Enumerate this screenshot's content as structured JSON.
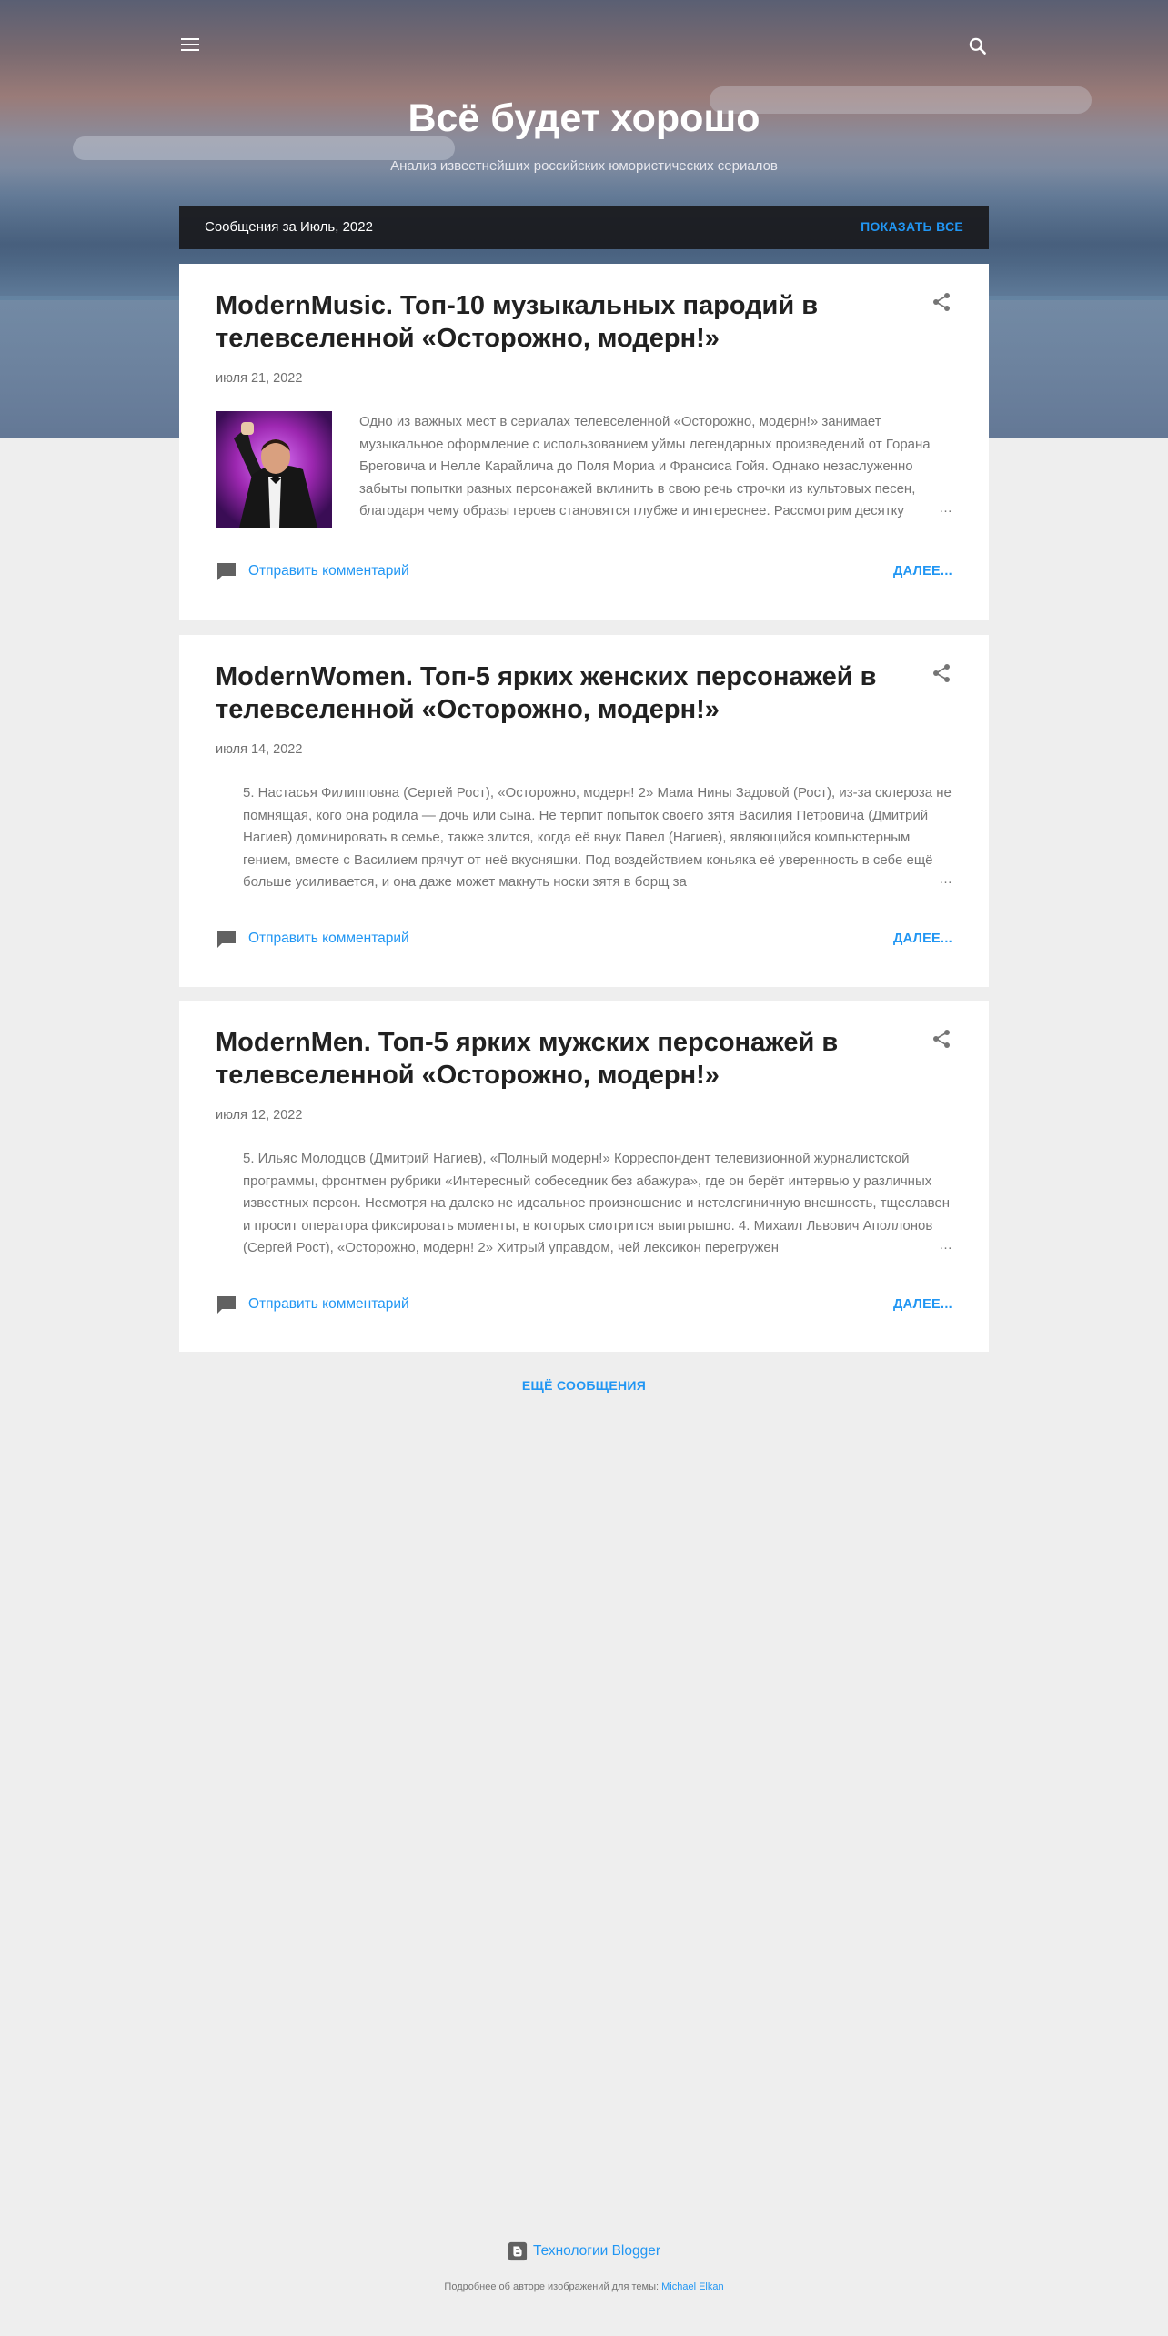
{
  "header": {
    "menu_icon": "hamburger-menu-icon",
    "search_icon": "search-icon",
    "title": "Всё будет хорошо",
    "subtitle": "Анализ известнейших российских юмористических сериалов"
  },
  "archive_bar": {
    "label": "Сообщения за Июль, 2022",
    "show_all": "ПОКАЗАТЬ ВСЕ"
  },
  "posts": [
    {
      "title": "ModernMusic. Топ-10 музыкальных пародий в телевселенной «Осторожно, модерн!»",
      "date": "июля 21, 2022",
      "has_thumbnail": true,
      "snippet": "Одно из важных мест в сериалах телевселенной «Осторожно, модерн!» занимает музыкальное оформление с использованием уймы легендарных произведений от Горана Бреговича и Нелле Карайлича до Поля Мориа и Франсиса Гойя. Однако незаслуженно забыты попытки разных персонажей вклинить в свою речь строчки из культовых песен, благодаря чему образы героев становятся глубже и интереснее. Рассмотрим десятку",
      "ellipsis": "…",
      "comment_label": "Отправить комментарий",
      "more_label": "ДАЛЕЕ..."
    },
    {
      "title": "ModernWomen. Топ-5 ярких женских персонажей в телевселенной «Осторожно, модерн!»",
      "date": "июля 14, 2022",
      "has_thumbnail": false,
      "snippet": "5. Настасья Филипповна (Сергей Рост), «Осторожно, модерн! 2» Мама Нины Задовой (Рост), из-за склероза не помнящая, кого она родила — дочь или сына. Не терпит попыток своего зятя Василия Петровича (Дмитрий Нагиев) доминировать в семье, также злится, когда её внук Павел (Нагиев), являющийся компьютерным гением, вместе с Василием прячут от неё вкусняшки. Под воздействием коньяка её уверенность в себе ещё больше усиливается, и она даже может макнуть носки зятя в борщ за",
      "ellipsis": "…",
      "comment_label": "Отправить комментарий",
      "more_label": "ДАЛЕЕ..."
    },
    {
      "title": "ModernMen. Топ-5 ярких мужских персонажей в телевселенной «Осторожно, модерн!»",
      "date": "июля 12, 2022",
      "has_thumbnail": false,
      "snippet": "5. Ильяс Молодцов (Дмитрий Нагиев), «Полный модерн!» Корреспондент телевизионной журналистской программы, фронтмен рубрики «Интересный собеседник без абажура», где он берёт интервью у различных известных персон. Несмотря на далеко не идеальное произношение и нетелегиничную внешность, тщеславен и просит оператора фиксировать моменты, в которых смотрится выигрышно. 4. Михаил Львович Аполлонов (Сергей Рост), «Осторожно, модерн! 2» Хитрый управдом, чей лексикон перегружен",
      "ellipsis": "…",
      "comment_label": "Отправить комментарий",
      "more_label": "ДАЛЕЕ..."
    }
  ],
  "more_posts": "ЕЩЁ СООБЩЕНИЯ",
  "footer": {
    "blogger_icon": "blogger-icon",
    "blogger_label": "Технологии Blogger",
    "credit_text": "Подробнее об авторе изображений для темы:",
    "credit_link": "Michael Elkan"
  },
  "colors": {
    "accent": "#2196f3",
    "page_bg": "#eeeeee",
    "card_bg": "#ffffff",
    "title_text": "#212121",
    "muted_text": "#757575",
    "bar_bg": "#19191c"
  }
}
